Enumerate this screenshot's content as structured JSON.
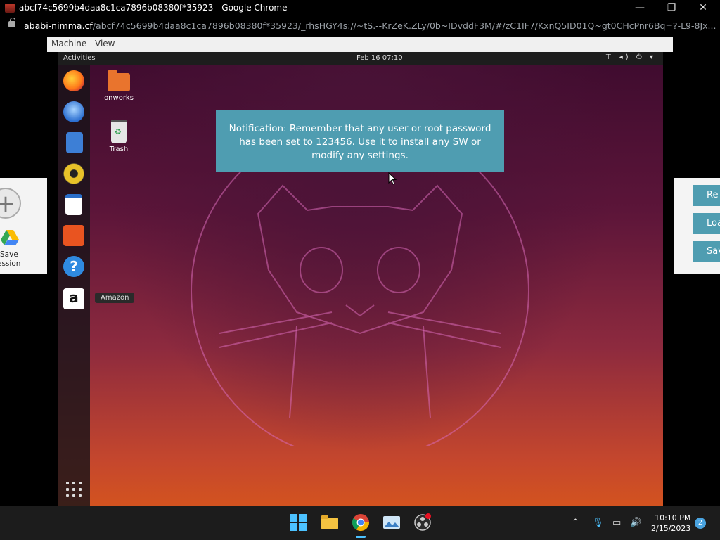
{
  "browser": {
    "window_title": "abcf74c5699b4daa8c1ca7896b08380f*35923 - Google Chrome",
    "url_host": "ababi-nimma.cf",
    "url_path": "/abcf74c5699b4daa8c1ca7896b08380f*35923/_rhsHGY4s://~tS.--KrZeK.ZLy/0b~IDvddF3M/#/zC1IF7/KxnQ5ID01Q~gt0CHcPnr6Bq=?-L9-8Jx...",
    "controls": {
      "minimize": "—",
      "restore": "❐",
      "close": "✕"
    }
  },
  "vm_menu": {
    "machine": "Machine",
    "view": "View"
  },
  "ubuntu": {
    "activities": "Activities",
    "clock": "Feb 16  07:10",
    "tray": "⊤ ◂) ⏻ ▾",
    "desktop_icons": [
      {
        "label": "onworks"
      },
      {
        "label": "Trash"
      }
    ],
    "dock_tooltip": "Amazon",
    "notification": "Notification: Remember that any user or root password has been set to 123456. Use it to install any SW or modify any settings."
  },
  "left_panel": {
    "save_label_1": "Save",
    "save_label_2": "ession"
  },
  "right_panel": {
    "btn1": "Re",
    "btn2": "Loa",
    "btn3": "Sav"
  },
  "taskbar": {
    "time": "10:10 PM",
    "date": "2/15/2023",
    "notifications": "2"
  },
  "colors": {
    "notification_bg": "#4f9db1",
    "ubuntu_orange": "#e9742d",
    "taskbar": "#1c1c1c"
  }
}
